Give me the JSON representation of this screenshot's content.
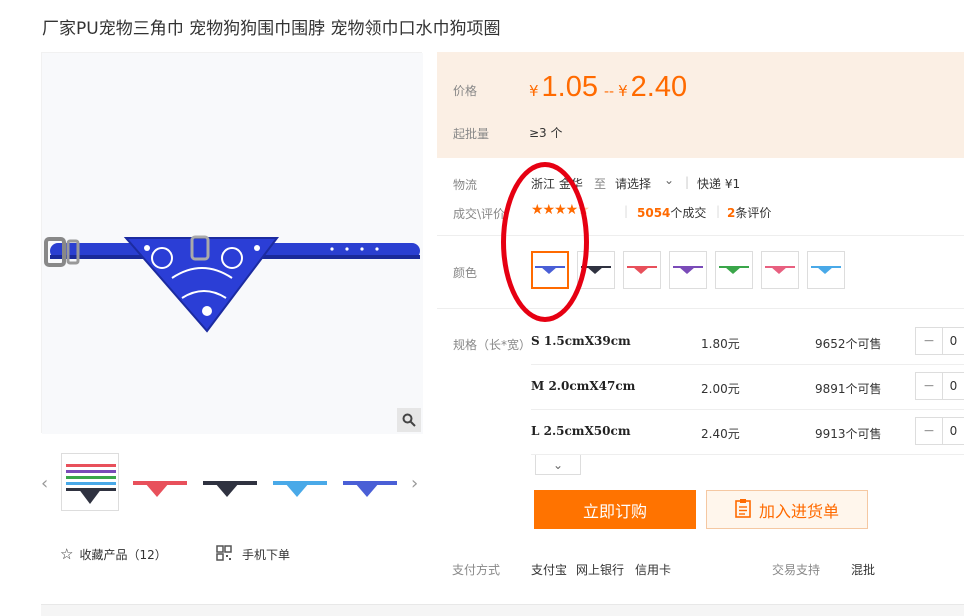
{
  "product": {
    "title": "厂家PU宠物三角巾 宠物狗狗围巾围脖 宠物领巾口水巾狗项圈"
  },
  "gallery": {
    "main_image": "blue-bandana-collar-image",
    "thumbnails": [
      "multi-color-bandanas",
      "red-bandana",
      "black-bandana",
      "light-blue-bandana",
      "blue-bandana"
    ],
    "prev_arrow": "‹",
    "next_arrow": "›"
  },
  "actions": {
    "favorite_label": "收藏产品（12）",
    "mobile_label": "手机下单"
  },
  "price": {
    "label": "价格",
    "currency": "¥",
    "min": "1.05",
    "separator": "--",
    "max": "2.40",
    "moq_label": "起批量",
    "moq_value": "≥3 个"
  },
  "logistics": {
    "label": "物流",
    "origin": "浙江 金华",
    "to": "至",
    "destination": "请选择",
    "shipping": "快递 ¥1",
    "review_label": "成交\\评价",
    "rating": 4.5,
    "deals_count": "5054",
    "deals_suffix": "个成交",
    "reviews_count": "2",
    "reviews_suffix": "条评价"
  },
  "color": {
    "label": "颜色",
    "options": [
      "#4a5fd6",
      "#2f3240",
      "#e8505b",
      "#7a4bb8",
      "#3aa64a",
      "#e86080",
      "#49a9e8"
    ],
    "selected_index": 0
  },
  "specs": {
    "label": "规格（长*宽）",
    "rows": [
      {
        "name": "S 1.5cmX39cm",
        "price": "1.80元",
        "stock": "9652个可售",
        "qty": "0"
      },
      {
        "name": "M 2.0cmX47cm",
        "price": "2.00元",
        "stock": "9891个可售",
        "qty": "0"
      },
      {
        "name": "L 2.5cmX50cm",
        "price": "2.40元",
        "stock": "9913个可售",
        "qty": "0"
      }
    ]
  },
  "buttons": {
    "buy": "立即订购",
    "add_cart": "加入进货单"
  },
  "payment": {
    "label": "支付方式",
    "methods": [
      "支付宝",
      "网上银行",
      "信用卡"
    ],
    "support_label": "交易支持",
    "support_value": "混批"
  },
  "colors": {
    "accent": "#ff6a00",
    "annotation": "#e60012"
  }
}
